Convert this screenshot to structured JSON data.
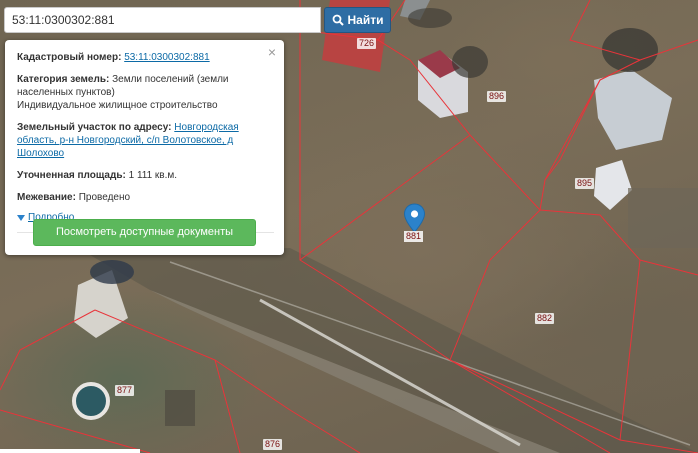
{
  "search": {
    "value": "53:11:0300302:881",
    "button_label": "Найти"
  },
  "popup": {
    "cadastral_label": "Кадастровый номер:",
    "cadastral_value": "53:11:0300302:881",
    "category_label": "Категория земель:",
    "category_value": "Земли поселений (земли населенных пунктов)",
    "use_value": "Индивидуальное жилищное строительство",
    "address_label": "Земельный участок по адресу:",
    "address_value": "Новгородская область, р-н Новгородский, с/п Волотовское, д Шолохово",
    "area_label": "Уточненная площадь:",
    "area_value": "1 111 кв.м.",
    "survey_label": "Межевание:",
    "survey_value": "Проведено",
    "more_label": "Подробно",
    "docs_button_label": "Посмотреть доступные документы",
    "close_glyph": "×"
  },
  "map": {
    "marker_label": "881",
    "parcel_labels": {
      "p726": "726",
      "p896": "896",
      "p895": "895",
      "p882": "882",
      "p877": "877",
      "p876": "876"
    }
  },
  "colors": {
    "boundary": "#e8343a",
    "primary_button": "#2e6da4",
    "success_button": "#5cb85c",
    "link": "#0c6aa6",
    "marker": "#2b82cb"
  }
}
